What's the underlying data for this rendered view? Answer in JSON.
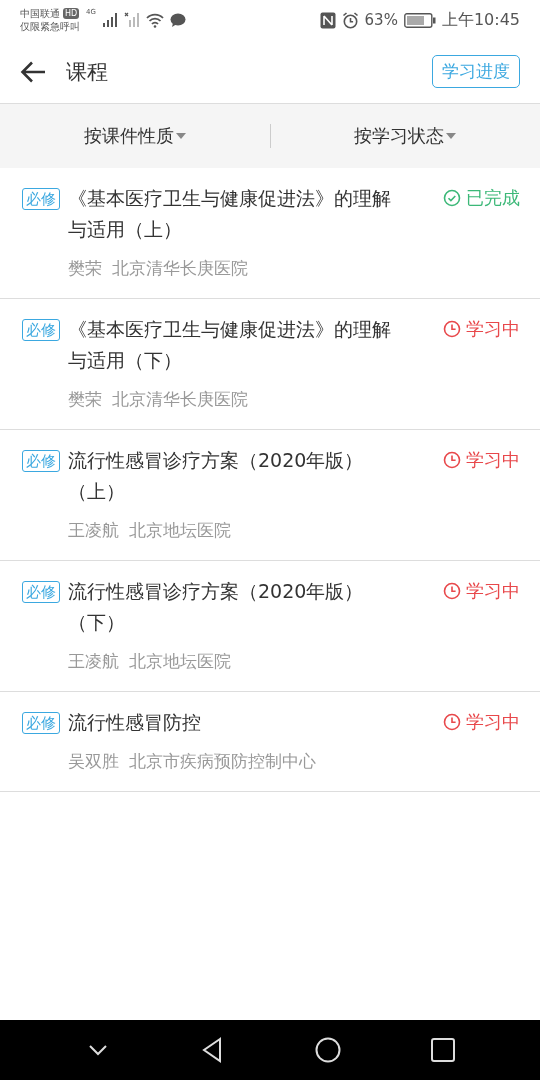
{
  "status_bar": {
    "carrier": "中国联通",
    "hd": "HD",
    "network": "4G",
    "emergency": "仅限紧急呼叫",
    "battery": "63%",
    "time": "上午10:45"
  },
  "header": {
    "title": "课程",
    "progress_button": "学习进度"
  },
  "filters": [
    {
      "label": "按课件性质"
    },
    {
      "label": "按学习状态"
    }
  ],
  "courses": [
    {
      "tag": "必修",
      "title": "《基本医疗卫生与健康促进法》的理解与适用（上）",
      "teacher": "樊荣",
      "hospital": "北京清华长庚医院",
      "status": {
        "kind": "done",
        "label": "已完成"
      }
    },
    {
      "tag": "必修",
      "title": "《基本医疗卫生与健康促进法》的理解与适用（下）",
      "teacher": "樊荣",
      "hospital": "北京清华长庚医院",
      "status": {
        "kind": "learning",
        "label": "学习中"
      }
    },
    {
      "tag": "必修",
      "title": "流行性感冒诊疗方案（2020年版）（上）",
      "teacher": "王凌航",
      "hospital": "北京地坛医院",
      "status": {
        "kind": "learning",
        "label": "学习中"
      }
    },
    {
      "tag": "必修",
      "title": "流行性感冒诊疗方案（2020年版）（下）",
      "teacher": "王凌航",
      "hospital": "北京地坛医院",
      "status": {
        "kind": "learning",
        "label": "学习中"
      }
    },
    {
      "tag": "必修",
      "title": "流行性感冒防控",
      "teacher": "吴双胜",
      "hospital": "北京市疾病预防控制中心",
      "status": {
        "kind": "learning",
        "label": "学习中"
      }
    }
  ]
}
